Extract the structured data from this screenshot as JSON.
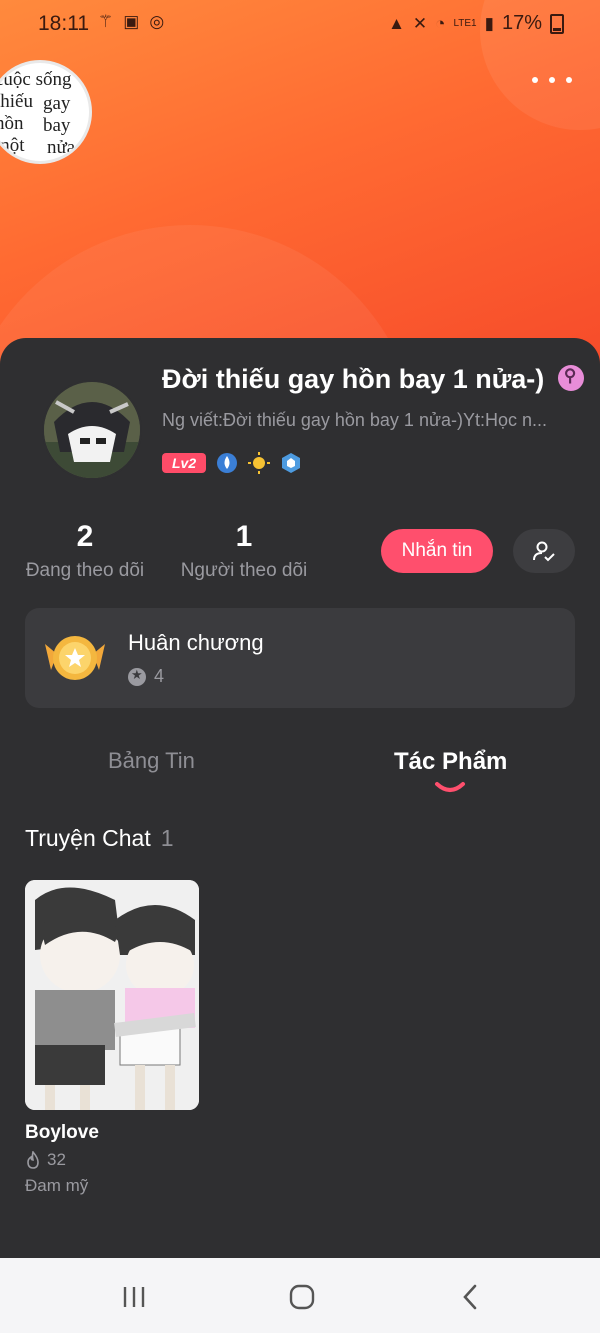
{
  "status_bar": {
    "time": "18:11",
    "battery": "17%",
    "network": "LTE1"
  },
  "sticker": {
    "lines": [
      "cuộc sống",
      "thiếu",
      "gay",
      "hồn",
      "bay",
      "một",
      "nửa"
    ]
  },
  "profile": {
    "name": "Đời thiếu gay hồn bay 1 nửa-)",
    "bio": "Ng viết:Đời thiếu gay hồn bay 1 nửa-)Yt:Học n...",
    "level": "Lv2"
  },
  "stats": {
    "following_count": "2",
    "following_label": "Đang theo dõi",
    "followers_count": "1",
    "followers_label": "Người theo dõi"
  },
  "actions": {
    "message_label": "Nhắn tin"
  },
  "medals": {
    "title": "Huân chương",
    "count": "4"
  },
  "tabs": {
    "news": "Bảng Tin",
    "works": "Tác Phẩm",
    "active": "works"
  },
  "section": {
    "title": "Truyện Chat",
    "count": "1"
  },
  "stories": [
    {
      "title": "Boylove",
      "views": "32",
      "genre": "Đam mỹ"
    }
  ],
  "colors": {
    "accent": "#ff4f6d",
    "header_orange": "#ff6a32",
    "background": "#2f2f31"
  }
}
